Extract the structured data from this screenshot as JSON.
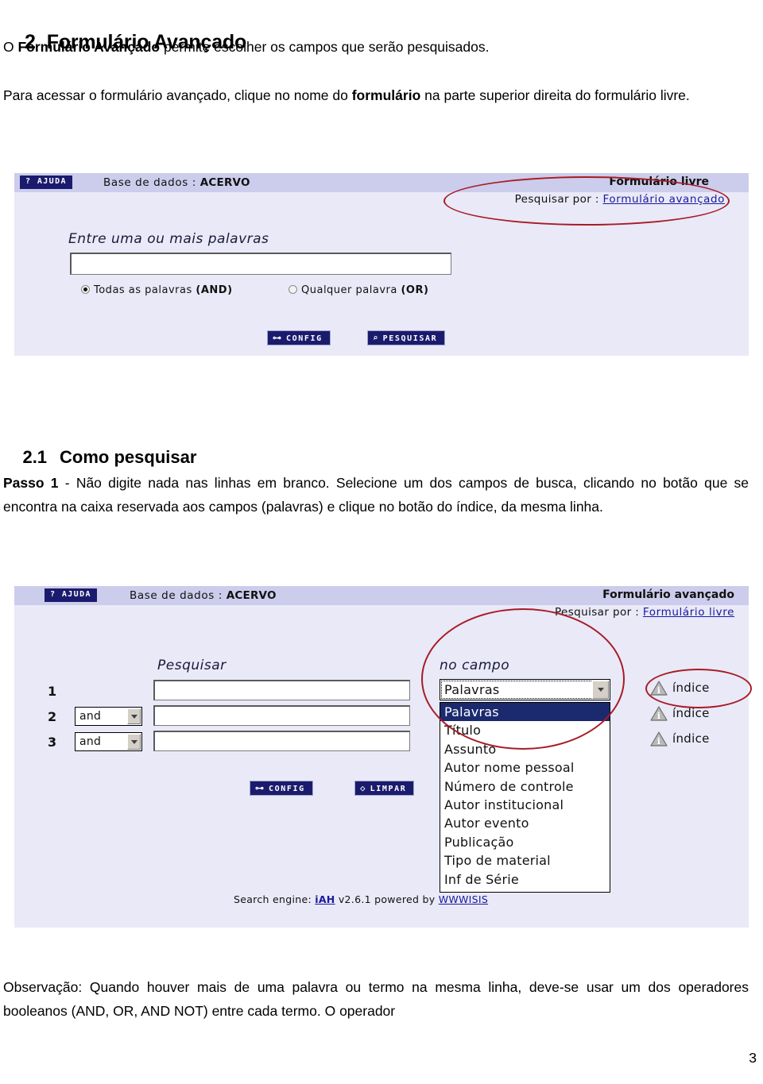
{
  "document": {
    "section_title": {
      "number": "2",
      "text": "Formulário Avançado"
    },
    "intro_para_prefix": "O ",
    "intro_para_bold": "Formulário Avançado",
    "intro_para_suffix": " permite escolher os campos que serão pesquisados.",
    "access_para_1": "Para acessar o formulário avançado, clique no nome do ",
    "access_para_bold": "formulário",
    "access_para_2": " na parte superior direita do formulário livre.",
    "subsection_title": {
      "number": "2.1",
      "text": "Como pesquisar"
    },
    "step_label": "Passo 1",
    "step_text": " - Não digite nada nas linhas em branco. Selecione um dos campos de busca, clicando no botão que se encontra na caixa reservada aos campos (palavras) e clique no botão do índice, da mesma linha.",
    "observation": "Observação: Quando houver mais de uma palavra ou termo na mesma linha, deve-se usar um dos operadores booleanos (AND, OR, AND NOT) entre cada termo. O operador",
    "page_number": "3"
  },
  "screenshot_free_form": {
    "help_button": "? AJUDA",
    "database_label": "Base de dados : ",
    "database_name": "ACERVO",
    "form_title": "Formulário livre",
    "search_by_label": "Pesquisar por : ",
    "search_by_link": "Formulário avançado",
    "input_label": "Entre uma ou mais palavras",
    "input_value": "",
    "radio_and": "Todas as palavras ",
    "radio_and_bold": "(AND)",
    "radio_or": "Qualquer palavra ",
    "radio_or_bold": "(OR)",
    "selected_operator": "AND",
    "buttons": [
      {
        "label": "CONFIG",
        "icon": "key-icon",
        "glyph": "⊶"
      },
      {
        "label": "PESQUISAR",
        "icon": "magnifier-icon",
        "glyph": "⌕"
      }
    ]
  },
  "screenshot_advanced_form": {
    "help_button": "? AJUDA",
    "database_label": "Base de dados : ",
    "database_name": "ACERVO",
    "form_title": "Formulário avançado",
    "search_by_label": "Pesquisar por : ",
    "search_by_link": "Formulário livre",
    "col_search_label": "Pesquisar",
    "col_field_label": "no campo",
    "rows": [
      {
        "num": "1",
        "operator": null,
        "value": "",
        "index_label": "índice"
      },
      {
        "num": "2",
        "operator": "and",
        "value": "",
        "index_label": "índice"
      },
      {
        "num": "3",
        "operator": "and",
        "value": "",
        "index_label": "índice"
      }
    ],
    "field_select_value": "Palavras",
    "field_options": [
      "Palavras",
      "Título",
      "Assunto",
      "Autor nome pessoal",
      "Número de controle",
      "Autor institucional",
      "Autor evento",
      "Publicação",
      "Tipo de material",
      "Inf de Série"
    ],
    "buttons": [
      {
        "label": "CONFIG",
        "icon": "key-icon",
        "glyph": "⊶"
      },
      {
        "label": "LIMPAR",
        "icon": "eraser-icon",
        "glyph": "◇"
      }
    ],
    "footer_prefix": "Search engine: ",
    "footer_engine": "iAH",
    "footer_version": " v2.6.1 powered by ",
    "footer_wwwisis": "WWWISIS"
  },
  "colors": {
    "navy": "#1b1b6e",
    "panel_bg": "#e9e9f8",
    "band_bg": "#ccccec",
    "link": "#1a1a9e",
    "annotation_red": "#a81b24",
    "highlight": "#1b2a6e"
  }
}
